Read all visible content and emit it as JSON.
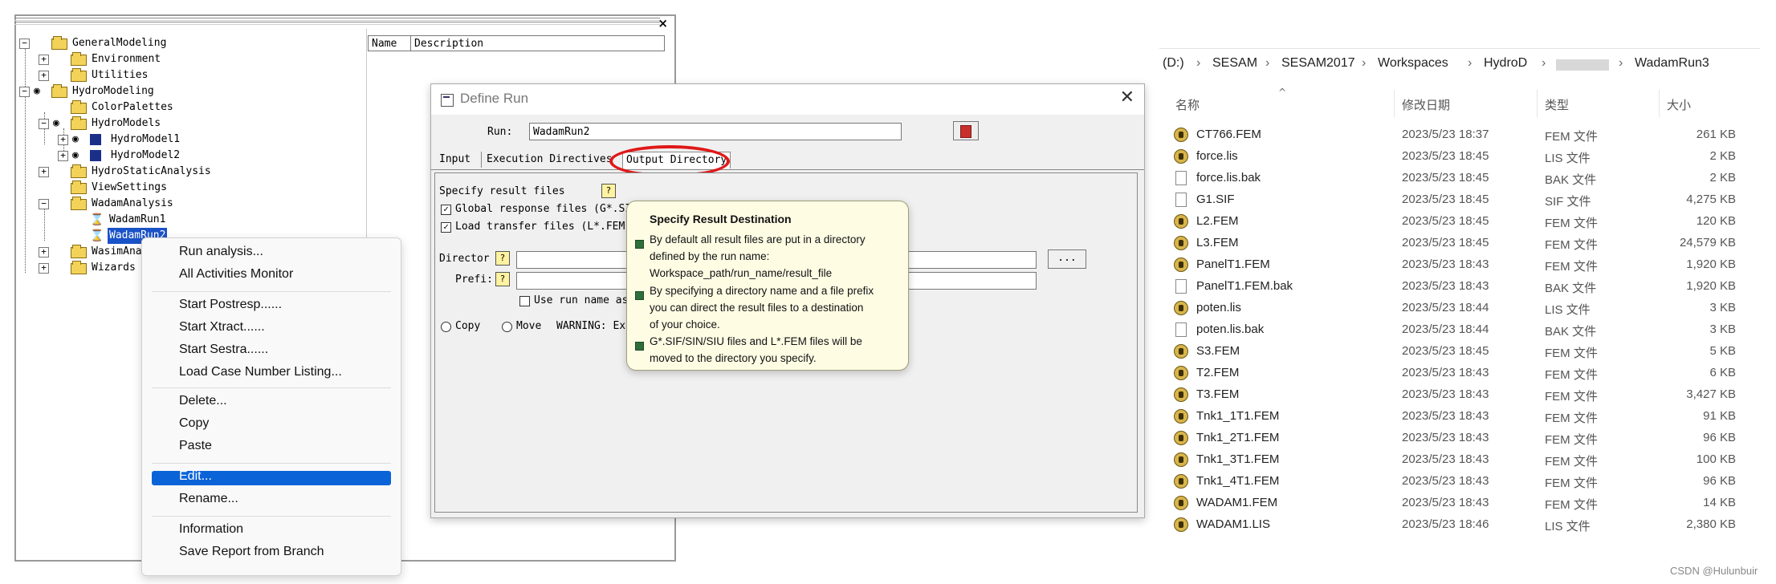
{
  "tree": {
    "close_glyph": "×",
    "items": [
      {
        "label": "GeneralModeling",
        "expander": "−",
        "icon": "folder"
      },
      {
        "label": "Environment",
        "expander": "+",
        "icon": "folder"
      },
      {
        "label": "Utilities",
        "expander": "+",
        "icon": "folder"
      },
      {
        "label": "HydroModeling",
        "expander": "−",
        "icon": "eye-folder"
      },
      {
        "label": "ColorPalettes",
        "expander": "",
        "icon": "folder"
      },
      {
        "label": "HydroModels",
        "expander": "−",
        "icon": "eye-folder"
      },
      {
        "label": "HydroModel1",
        "expander": "+",
        "icon": "eye-model"
      },
      {
        "label": "HydroModel2",
        "expander": "+",
        "icon": "eye-model"
      },
      {
        "label": "HydroStaticAnalysis",
        "expander": "+",
        "icon": "folder"
      },
      {
        "label": "ViewSettings",
        "expander": "",
        "icon": "folder"
      },
      {
        "label": "WadamAnalysis",
        "expander": "−",
        "icon": "folder"
      },
      {
        "label": "WadamRun1",
        "expander": "",
        "icon": "hourglass"
      },
      {
        "label": "WadamRun2",
        "expander": "",
        "icon": "hourglass",
        "selected": true
      },
      {
        "label": "WasimAna",
        "expander": "+",
        "icon": "folder"
      },
      {
        "label": "Wizards",
        "expander": "+",
        "icon": "folder"
      }
    ]
  },
  "list_panel": {
    "col_name": "Name",
    "col_description": "Description"
  },
  "context_menu": {
    "items": [
      "Run analysis...",
      "All Activities Monitor",
      "Start Postresp......",
      "Start Xtract......",
      "Start Sestra......",
      "Load Case Number Listing...",
      "Delete...",
      "Copy",
      "Paste",
      "Edit...",
      "Rename...",
      "Information",
      "Save Report from Branch"
    ],
    "selected": "Edit..."
  },
  "dialog": {
    "title": "Define Run",
    "close_glyph": "✕",
    "run_label": "Run:",
    "run_value": "WadamRun2",
    "tabs": [
      "Input",
      "Execution Directives",
      "Output Directory"
    ],
    "active_tab": "Output Directory",
    "specify_label": "Specify result files",
    "global_check_label": "Global response files (G*.SI",
    "load_check_label": "Load transfer files (L*.FEM",
    "director_label": "Director",
    "prefix_label": "Prefi:",
    "use_run_name_label": "Use run name as",
    "browse_label": "...",
    "copy_label": "Copy",
    "move_label": "Move",
    "warning_text": "WARNING: Exi",
    "bulb_glyph": "?"
  },
  "tooltip": {
    "title": "Specify Result Destination",
    "bullets": [
      [
        "By default all result files are put in a directory",
        "defined by the run name:",
        "Workspace_path/run_name/result_file"
      ],
      [
        "By specifying a directory name and a file prefix",
        "you can direct the result files to a destination",
        "of your choice."
      ],
      [
        "G*.SIF/SIN/SIU files and L*.FEM files will be",
        "moved to the directory you specify."
      ]
    ]
  },
  "explorer": {
    "breadcrumb": [
      "(D:)",
      "SESAM",
      "SESAM2017",
      "Workspaces",
      "HydroD",
      "WadamRun3"
    ],
    "sep": "›",
    "sort_glyph": "^",
    "columns": {
      "name": "名称",
      "date": "修改日期",
      "type": "类型",
      "size": "大小"
    },
    "files": [
      {
        "name": "CT766.FEM",
        "date": "2023/5/23 18:37",
        "type": "FEM 文件",
        "size": "261 KB",
        "icon": "app"
      },
      {
        "name": "force.lis",
        "date": "2023/5/23 18:45",
        "type": "LIS 文件",
        "size": "2 KB",
        "icon": "app"
      },
      {
        "name": "force.lis.bak",
        "date": "2023/5/23 18:45",
        "type": "BAK 文件",
        "size": "2 KB",
        "icon": "doc"
      },
      {
        "name": "G1.SIF",
        "date": "2023/5/23 18:45",
        "type": "SIF 文件",
        "size": "4,275 KB",
        "icon": "doc"
      },
      {
        "name": "L2.FEM",
        "date": "2023/5/23 18:45",
        "type": "FEM 文件",
        "size": "120 KB",
        "icon": "app"
      },
      {
        "name": "L3.FEM",
        "date": "2023/5/23 18:45",
        "type": "FEM 文件",
        "size": "24,579 KB",
        "icon": "app"
      },
      {
        "name": "PanelT1.FEM",
        "date": "2023/5/23 18:43",
        "type": "FEM 文件",
        "size": "1,920 KB",
        "icon": "app"
      },
      {
        "name": "PanelT1.FEM.bak",
        "date": "2023/5/23 18:43",
        "type": "BAK 文件",
        "size": "1,920 KB",
        "icon": "doc"
      },
      {
        "name": "poten.lis",
        "date": "2023/5/23 18:44",
        "type": "LIS 文件",
        "size": "3 KB",
        "icon": "app"
      },
      {
        "name": "poten.lis.bak",
        "date": "2023/5/23 18:44",
        "type": "BAK 文件",
        "size": "3 KB",
        "icon": "doc"
      },
      {
        "name": "S3.FEM",
        "date": "2023/5/23 18:45",
        "type": "FEM 文件",
        "size": "5 KB",
        "icon": "app"
      },
      {
        "name": "T2.FEM",
        "date": "2023/5/23 18:43",
        "type": "FEM 文件",
        "size": "6 KB",
        "icon": "app"
      },
      {
        "name": "T3.FEM",
        "date": "2023/5/23 18:43",
        "type": "FEM 文件",
        "size": "3,427 KB",
        "icon": "app"
      },
      {
        "name": "Tnk1_1T1.FEM",
        "date": "2023/5/23 18:43",
        "type": "FEM 文件",
        "size": "91 KB",
        "icon": "app"
      },
      {
        "name": "Tnk1_2T1.FEM",
        "date": "2023/5/23 18:43",
        "type": "FEM 文件",
        "size": "96 KB",
        "icon": "app"
      },
      {
        "name": "Tnk1_3T1.FEM",
        "date": "2023/5/23 18:43",
        "type": "FEM 文件",
        "size": "100 KB",
        "icon": "app"
      },
      {
        "name": "Tnk1_4T1.FEM",
        "date": "2023/5/23 18:43",
        "type": "FEM 文件",
        "size": "96 KB",
        "icon": "app"
      },
      {
        "name": "WADAM1.FEM",
        "date": "2023/5/23 18:43",
        "type": "FEM 文件",
        "size": "14 KB",
        "icon": "app"
      },
      {
        "name": "WADAM1.LIS",
        "date": "2023/5/23 18:46",
        "type": "LIS 文件",
        "size": "2,380 KB",
        "icon": "app"
      }
    ]
  },
  "watermark": "CSDN @Hulunbuir",
  "colors": {
    "selection": "#0a64d8",
    "tree_selection": "#1a52c7",
    "highlight_ring": "#e01818",
    "tooltip_bg": "#fffce4"
  }
}
